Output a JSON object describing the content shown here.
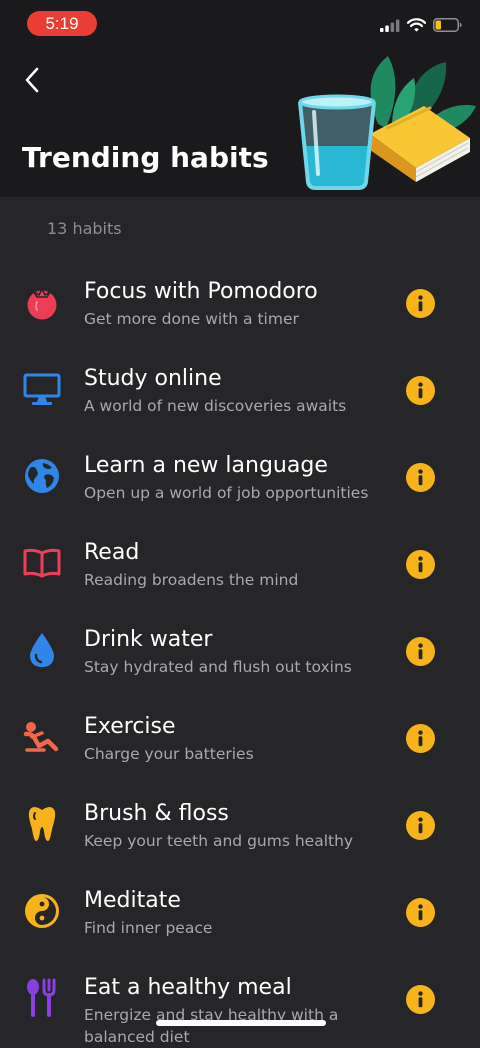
{
  "status_bar": {
    "time": "5:19",
    "time_pill_color": "#ea3d34",
    "icons": [
      "cellular-signal-icon",
      "wifi-icon",
      "battery-icon"
    ]
  },
  "header": {
    "back_icon": "chevron-left-icon",
    "title": "Trending habits",
    "illustration": [
      "glass-of-water",
      "yellow-book",
      "green-leaves"
    ]
  },
  "count_label": "13 habits",
  "accent_color": "#f6b41a",
  "habits": [
    {
      "title": "Focus with Pomodoro",
      "subtitle": "Get more done with a timer",
      "icon": "tomato-icon",
      "icon_color": "#ed3d55"
    },
    {
      "title": "Study online",
      "subtitle": "A world of new discoveries awaits",
      "icon": "monitor-icon",
      "icon_color": "#2f86e8"
    },
    {
      "title": "Learn a new language",
      "subtitle": "Open up a world of job opportunities",
      "icon": "globe-icon",
      "icon_color": "#2f86e8"
    },
    {
      "title": "Read",
      "subtitle": "Reading broadens the mind",
      "icon": "open-book-icon",
      "icon_color": "#ea3f5c"
    },
    {
      "title": "Drink water",
      "subtitle": "Stay hydrated and flush out toxins",
      "icon": "water-drop-icon",
      "icon_color": "#2f86e8"
    },
    {
      "title": "Exercise",
      "subtitle": "Charge your batteries",
      "icon": "sit-up-person-icon",
      "icon_color": "#f0684a"
    },
    {
      "title": "Brush & floss",
      "subtitle": "Keep your teeth and gums healthy",
      "icon": "tooth-icon",
      "icon_color": "#f6b41a"
    },
    {
      "title": "Meditate",
      "subtitle": "Find inner peace",
      "icon": "yin-yang-icon",
      "icon_color": "#f6b41a"
    },
    {
      "title": "Eat a healthy meal",
      "subtitle": "Energize and stay healthy with a balanced diet",
      "icon": "fork-knife-icon",
      "icon_color": "#8a3fe0"
    }
  ]
}
